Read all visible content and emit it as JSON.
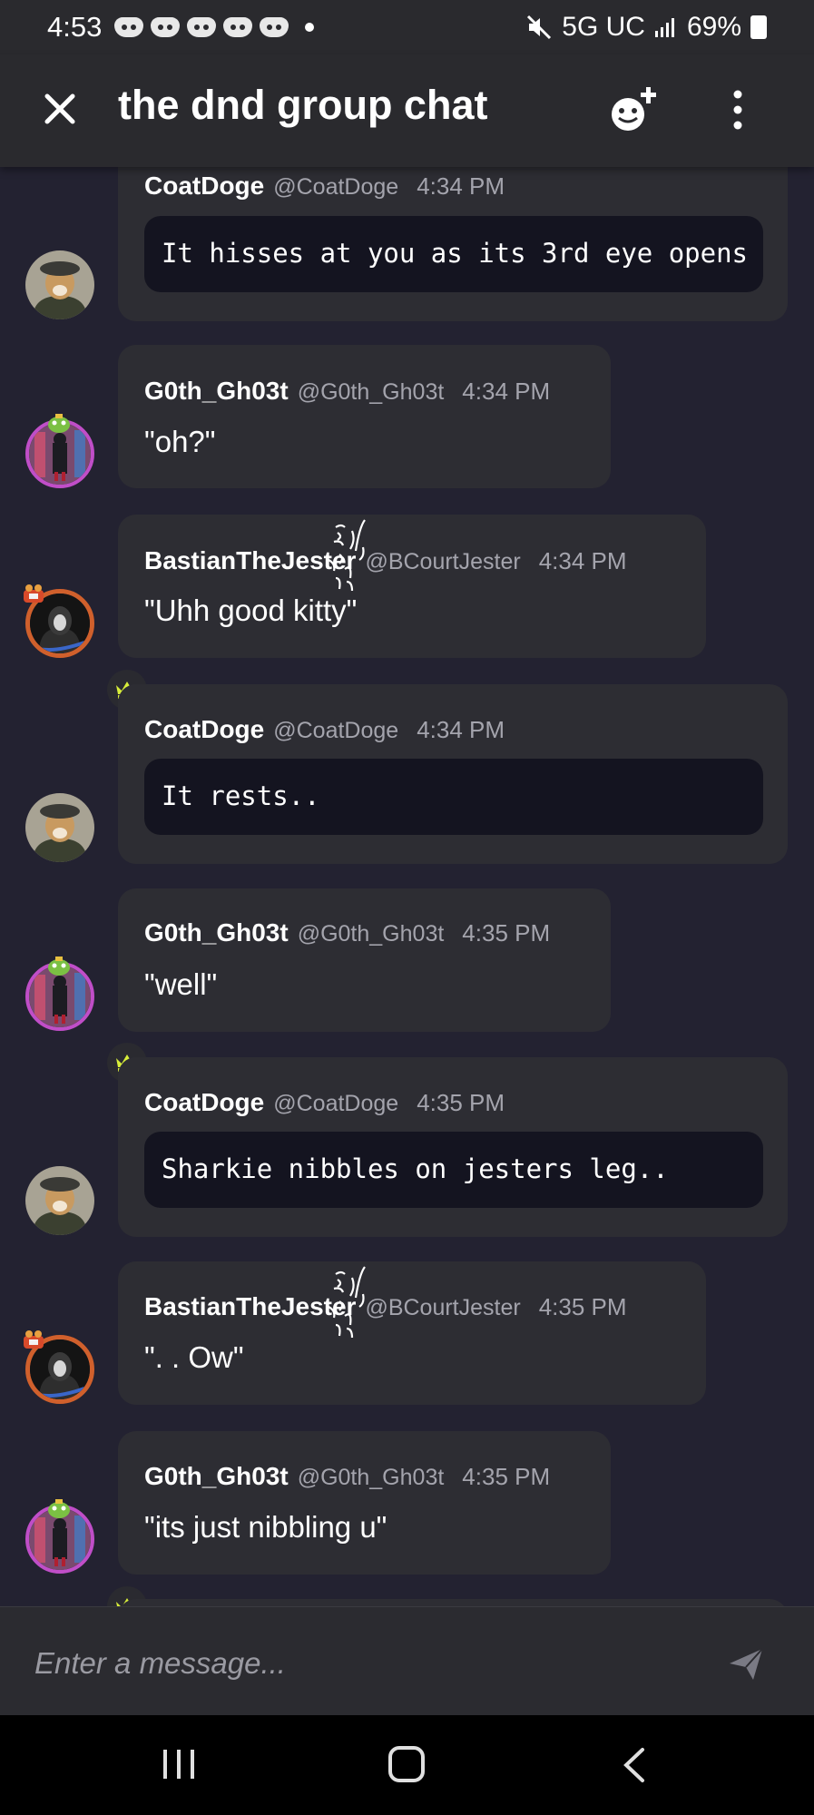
{
  "status_bar": {
    "time": "4:53",
    "network": "5G UC",
    "battery": "69%"
  },
  "header": {
    "title": "the dnd group chat"
  },
  "messages": [
    {
      "name": "CoatDoge",
      "handle": "@CoatDoge",
      "time": "4:34 PM",
      "text": "It hisses at you as its 3rd eye opens",
      "is_code": true,
      "owner": false
    },
    {
      "name": "G0th_Gh03t",
      "handle": "@G0th_Gh03t",
      "time": "4:34 PM",
      "text": "\"oh?\"",
      "is_code": false
    },
    {
      "name": "BastianTheJester",
      "handle": "@BCourtJester",
      "time": "4:34 PM",
      "text": "\"Uhh good kitty\"",
      "is_code": false
    },
    {
      "name": "CoatDoge",
      "handle": "@CoatDoge",
      "time": "4:34 PM",
      "text": "It rests..",
      "is_code": true,
      "owner": true
    },
    {
      "name": "G0th_Gh03t",
      "handle": "@G0th_Gh03t",
      "time": "4:35 PM",
      "text": "\"well\"",
      "is_code": false
    },
    {
      "name": "CoatDoge",
      "handle": "@CoatDoge",
      "time": "4:35 PM",
      "text": "Sharkie nibbles on jesters leg..",
      "is_code": true,
      "owner": true
    },
    {
      "name": "BastianTheJester",
      "handle": "@BCourtJester",
      "time": "4:35 PM",
      "text": "\". . Ow\"",
      "is_code": false
    },
    {
      "name": "G0th_Gh03t",
      "handle": "@G0th_Gh03t",
      "time": "4:35 PM",
      "text": "\"its just nibbling u\"",
      "is_code": false
    }
  ],
  "composer": {
    "placeholder": "Enter a message..."
  },
  "icons": {
    "close": "close-icon",
    "add_member": "add-emoji-icon",
    "menu": "kebab-menu-icon",
    "send": "send-icon",
    "owner_badge": "crown-icon"
  },
  "colors": {
    "background": "#232231",
    "bubble": "#2d2d33",
    "code_block": "#141420",
    "crown": "#d8ee3a"
  }
}
